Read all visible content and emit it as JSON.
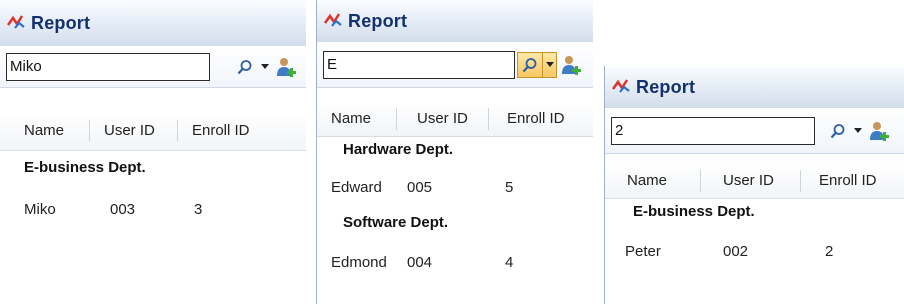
{
  "colors": {
    "title_text": "#14306d",
    "accent_orange": "#f7c762",
    "border": "#9fb1c8"
  },
  "panels": [
    {
      "title": "Report",
      "search_value": "Miko",
      "columns": [
        "Name",
        "User ID",
        "Enroll ID"
      ],
      "groups": [
        {
          "name": "E-business Dept.",
          "rows": [
            {
              "name": "Miko",
              "user_id": "003",
              "enroll_id": "3"
            }
          ]
        }
      ]
    },
    {
      "title": "Report",
      "search_value": "E",
      "columns": [
        "Name",
        "User ID",
        "Enroll ID"
      ],
      "groups": [
        {
          "name": "Hardware Dept.",
          "rows": [
            {
              "name": "Edward",
              "user_id": "005",
              "enroll_id": "5"
            }
          ]
        },
        {
          "name": "Software Dept.",
          "rows": [
            {
              "name": "Edmond",
              "user_id": "004",
              "enroll_id": "4"
            }
          ]
        }
      ]
    },
    {
      "title": "Report",
      "search_value": "2",
      "columns": [
        "Name",
        "User ID",
        "Enroll ID"
      ],
      "groups": [
        {
          "name": "E-business Dept.",
          "rows": [
            {
              "name": "Peter",
              "user_id": "002",
              "enroll_id": "2"
            }
          ]
        }
      ]
    }
  ]
}
